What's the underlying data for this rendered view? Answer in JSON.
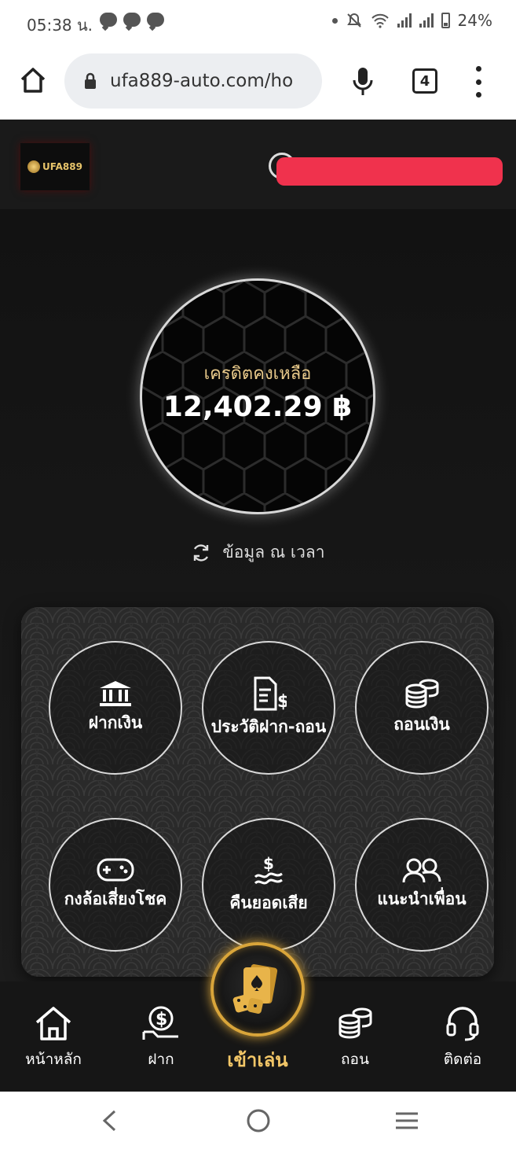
{
  "status_bar": {
    "time": "05:38 น.",
    "battery": "24%",
    "notification_icons": [
      "line-icon",
      "chat-icon",
      "line-icon"
    ]
  },
  "browser": {
    "url": "ufa889-auto.com/ho",
    "tab_count": "4"
  },
  "header": {
    "logo_text": "UFA889"
  },
  "balance": {
    "label": "เครดิตคงเหลือ",
    "value": "12,402.29 ฿",
    "refresh_text": "ข้อมูล ณ เวลา"
  },
  "menu": {
    "deposit": "ฝากเงิน",
    "history": "ประวัติฝาก-ถอน",
    "withdraw": "ถอนเงิน",
    "lucky_wheel": "กงล้อเสี่ยงโชค",
    "cashback": "คืนยอดเสีย",
    "referral": "แนะนำเพื่อน"
  },
  "bottom_nav": {
    "home": "หน้าหลัก",
    "deposit": "ฝาก",
    "play": "เข้าเล่น",
    "withdraw": "ถอน",
    "contact": "ติดต่อ"
  },
  "colors": {
    "accent_gold": "#f2c667",
    "redaction": "#f0324d",
    "background": "#121212"
  }
}
